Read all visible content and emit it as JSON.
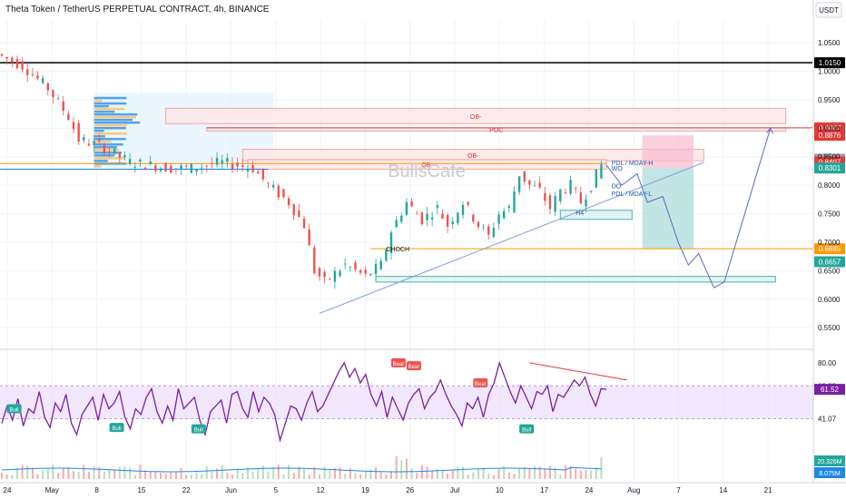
{
  "header": {
    "title": "Theta Token / TetherUS PERPETUAL CONTRACT, 4h, BINANCE",
    "currency": "USDT"
  },
  "watermark": "BullsCafe",
  "colors": {
    "up": "#26a69a",
    "down": "#ef5350",
    "rsi": "#7b1fa2",
    "rsi_band": "#e9d8fb",
    "trendline": "#7e9ee0",
    "black_level": "#000000",
    "red_level": "#e53935",
    "orange_level": "#ff9800",
    "blue_level": "#1e88e5"
  },
  "chart_data": [
    {
      "type": "line",
      "title": "Theta Token / TetherUS PERPETUAL CONTRACT, 4h, BINANCE",
      "x_ticks": [
        "24",
        "May",
        "8",
        "15",
        "22",
        "Jun",
        "5",
        "12",
        "19",
        "26",
        "Jul",
        "10",
        "17",
        "24",
        "Aug",
        "7",
        "14",
        "21"
      ],
      "y_ticks": [
        "1.0500",
        "1.0000",
        "0.9500",
        "0.9000",
        "0.8500",
        "0.8000",
        "0.7500",
        "0.7000",
        "0.6500",
        "0.6000",
        "0.5500"
      ],
      "ylim": [
        0.52,
        1.09
      ],
      "series": [
        {
          "name": "",
          "points": [
            [
              0,
              1.03
            ],
            [
              5,
              1.01
            ],
            [
              10,
              0.97
            ],
            [
              14,
              0.92
            ],
            [
              16,
              0.88
            ],
            [
              20,
              0.87
            ],
            [
              26,
              0.84
            ],
            [
              34,
              0.83
            ],
            [
              38,
              0.83
            ],
            [
              44,
              0.84
            ],
            [
              50,
              0.83
            ],
            [
              53,
              0.8
            ],
            [
              57,
              0.77
            ],
            [
              60,
              0.73
            ],
            [
              62,
              0.65
            ],
            [
              64,
              0.63
            ],
            [
              68,
              0.66
            ],
            [
              72,
              0.64
            ],
            [
              75,
              0.66
            ],
            [
              77,
              0.72
            ],
            [
              80,
              0.77
            ],
            [
              83,
              0.74
            ],
            [
              86,
              0.76
            ],
            [
              88,
              0.73
            ],
            [
              91,
              0.77
            ],
            [
              94,
              0.73
            ],
            [
              96,
              0.71
            ],
            [
              98,
              0.75
            ],
            [
              100,
              0.76
            ],
            [
              102,
              0.82
            ],
            [
              104,
              0.8
            ],
            [
              106,
              0.79
            ],
            [
              108,
              0.76
            ],
            [
              110,
              0.79
            ],
            [
              112,
              0.8
            ],
            [
              114,
              0.77
            ],
            [
              116,
              0.8
            ],
            [
              118,
              0.835
            ]
          ]
        }
      ],
      "projection": [
        [
          118,
          0.835
        ],
        [
          121,
          0.8
        ],
        [
          124,
          0.82
        ],
        [
          126,
          0.77
        ],
        [
          129,
          0.78
        ],
        [
          132,
          0.7
        ],
        [
          134,
          0.66
        ],
        [
          136,
          0.68
        ],
        [
          139,
          0.62
        ],
        [
          141,
          0.63
        ],
        [
          145,
          0.75
        ],
        [
          150,
          0.9
        ]
      ],
      "levels": [
        {
          "label": "1.0150",
          "value": 1.015,
          "style": "black"
        },
        {
          "label": "0.9007",
          "value": 0.9007,
          "style": "red"
        },
        {
          "label": "0.8876",
          "value": 0.8876,
          "style": "red"
        },
        {
          "label": "0.8456",
          "value": 0.8456,
          "style": "gray"
        },
        {
          "label": "0.8407",
          "value": 0.8407,
          "style": "red"
        },
        {
          "label": "0.8301",
          "value": 0.8301,
          "style": "green"
        },
        {
          "label": "0.6885",
          "value": 0.6885,
          "style": "orange"
        },
        {
          "label": "0.6657",
          "value": 0.6657,
          "style": "green"
        }
      ],
      "current_price": "0.8301",
      "countdown": "02:30:51",
      "zones": [
        {
          "label": "OB-",
          "top": 0.935,
          "bottom": 0.908,
          "x0": 32,
          "x1": 153
        },
        {
          "label": "POC",
          "top": 0.9007,
          "bottom": 0.895,
          "x0": 40,
          "x1": 153
        },
        {
          "label": "OB-",
          "top": 0.863,
          "bottom": 0.843,
          "x0": 47,
          "x1": 137
        },
        {
          "label": "OB-",
          "top": 0.845,
          "bottom": 0.828,
          "x0": 48,
          "x1": 118
        },
        {
          "label": "",
          "top": 0.64,
          "bottom": 0.63,
          "x0": 73,
          "x1": 151
        },
        {
          "label": "",
          "top": 0.756,
          "bottom": 0.74,
          "x0": 109,
          "x1": 123
        }
      ],
      "annotations": [
        "PDL / MDAY-H",
        "WO",
        "DO",
        "PDL / MDAY-L",
        "H4",
        "CHOCH"
      ],
      "position": {
        "entry": 0.8301,
        "stop": 0.8876,
        "target": 0.6885
      }
    },
    {
      "type": "line",
      "title": "",
      "y_ticks": [
        "80.00",
        "63.89",
        "41.07"
      ],
      "ylim": [
        18,
        85
      ],
      "band": [
        41.07,
        63.89
      ],
      "value_label": "61.52",
      "series": [
        {
          "name": "",
          "values": [
            38,
            50,
            40,
            55,
            36,
            48,
            45,
            60,
            42,
            35,
            52,
            46,
            58,
            38,
            30,
            44,
            50,
            56,
            40,
            58,
            48,
            52,
            60,
            42,
            34,
            48,
            44,
            56,
            62,
            46,
            38,
            50,
            40,
            62,
            48,
            52,
            56,
            40,
            30,
            46,
            50,
            54,
            38,
            58,
            60,
            48,
            42,
            60,
            46,
            56,
            52,
            44,
            26,
            38,
            50,
            48,
            40,
            52,
            60,
            46,
            50,
            58,
            66,
            74,
            80,
            70,
            76,
            66,
            72,
            58,
            50,
            60,
            42,
            56,
            48,
            40,
            52,
            58,
            62,
            48,
            56,
            60,
            68,
            58,
            50,
            44,
            36,
            52,
            48,
            56,
            42,
            58,
            66,
            80,
            70,
            60,
            52,
            64,
            56,
            48,
            60,
            58,
            64,
            46,
            58,
            56,
            62,
            68,
            64,
            70,
            58,
            50,
            62,
            61.5
          ]
        }
      ],
      "labels": [
        "Bull",
        "Bull",
        "Bull",
        "Bear",
        "Bear",
        "Bear",
        "Bull"
      ]
    },
    {
      "type": "bar",
      "title": "",
      "value_labels": [
        "20.326M",
        "8.075M"
      ]
    }
  ]
}
